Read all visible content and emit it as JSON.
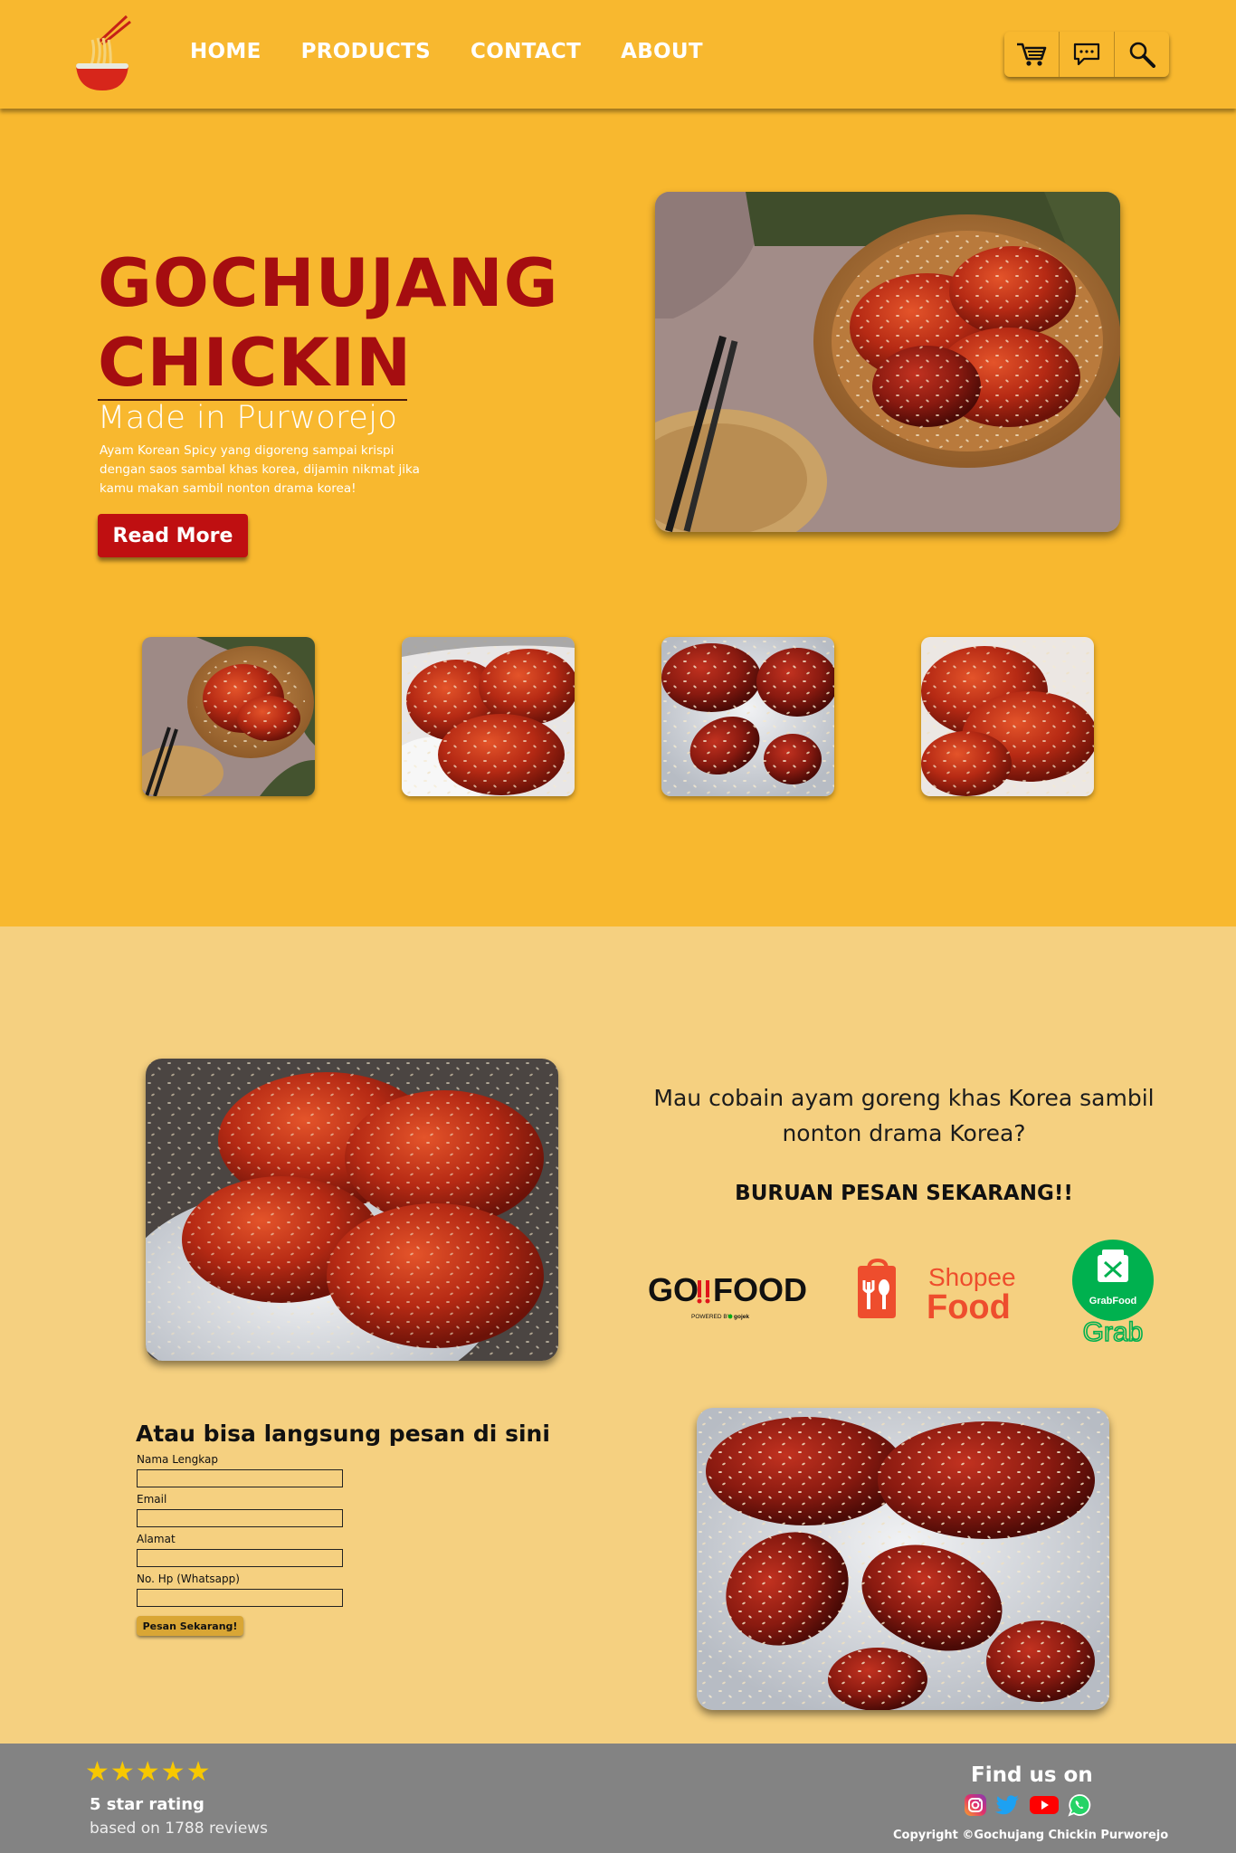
{
  "brand": {
    "logo_icon": "noodle-bowl-icon",
    "colors": {
      "primary": "#f8b82f",
      "secondary": "#f5d080",
      "accent_red": "#a50d10",
      "button_red": "#bf0f11",
      "footer": "#838383"
    }
  },
  "nav": {
    "items": [
      {
        "label": "HOME"
      },
      {
        "label": "PRODUCTS"
      },
      {
        "label": "CONTACT"
      },
      {
        "label": "ABOUT"
      }
    ],
    "icons": [
      "cart-icon",
      "chat-icon",
      "search-icon"
    ]
  },
  "hero": {
    "title_line1": "GOCHUJANG",
    "title_line2": "CHICKIN",
    "subtitle": "Made in Purworejo",
    "description": "Ayam Korean Spicy yang digoreng sampai krispi dengan saos sambal khas korea, dijamin nikmat jika kamu makan sambil nonton drama korea!",
    "button_label": "Read More"
  },
  "promo": {
    "question": "Mau cobain ayam goreng khas Korea sambil nonton drama Korea?",
    "cta": "BURUAN PESAN SEKARANG!!",
    "partners": {
      "gofood": {
        "name": "GO FOOD",
        "tagline": "POWERED BY gojek",
        "color": "#111111",
        "accent": "#e0151b"
      },
      "shopee": {
        "line1": "Shopee",
        "line2": "Food",
        "color": "#ee4d2d"
      },
      "grab": {
        "badge": "GrabFood",
        "name": "Grab",
        "color": "#00b14f"
      }
    }
  },
  "form": {
    "title": "Atau bisa langsung pesan di sini",
    "fields": [
      {
        "label": "Nama Lengkap",
        "value": ""
      },
      {
        "label": "Email",
        "value": ""
      },
      {
        "label": "Alamat",
        "value": ""
      },
      {
        "label": "No. Hp (Whatsapp)",
        "value": ""
      }
    ],
    "submit_label": "Pesan Sekarang!"
  },
  "footer": {
    "stars": "★★★★★",
    "star_count": 5,
    "rating_title": "5 star rating",
    "rating_sub": "based on 1788 reviews",
    "find_us": "Find us on",
    "socials": [
      "instagram-icon",
      "twitter-icon",
      "youtube-icon",
      "whatsapp-icon"
    ],
    "copyright": "Copyright ©Gochujang Chickin Purworejo"
  }
}
